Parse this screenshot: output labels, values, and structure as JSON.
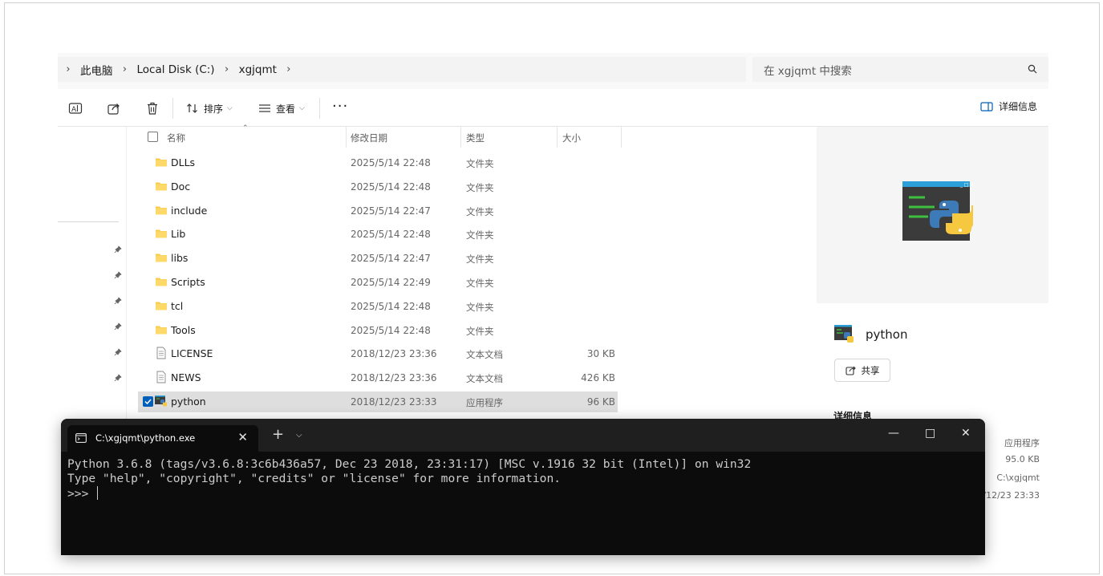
{
  "breadcrumb": {
    "items": [
      "此电脑",
      "Local Disk (C:)",
      "xgjqmt"
    ]
  },
  "search": {
    "placeholder": "在 xgjqmt 中搜索"
  },
  "toolbar": {
    "sort_label": "排序",
    "view_label": "查看",
    "more_label": "···",
    "details_label": "详细信息"
  },
  "columns": {
    "name": "名称",
    "date": "修改日期",
    "type": "类型",
    "size": "大小"
  },
  "files": [
    {
      "name": "DLLs",
      "date": "2025/5/14 22:48",
      "type": "文件夹",
      "size": "",
      "icon": "folder-icon"
    },
    {
      "name": "Doc",
      "date": "2025/5/14 22:48",
      "type": "文件夹",
      "size": "",
      "icon": "folder-icon"
    },
    {
      "name": "include",
      "date": "2025/5/14 22:47",
      "type": "文件夹",
      "size": "",
      "icon": "folder-icon"
    },
    {
      "name": "Lib",
      "date": "2025/5/14 22:48",
      "type": "文件夹",
      "size": "",
      "icon": "folder-icon"
    },
    {
      "name": "libs",
      "date": "2025/5/14 22:47",
      "type": "文件夹",
      "size": "",
      "icon": "folder-icon"
    },
    {
      "name": "Scripts",
      "date": "2025/5/14 22:49",
      "type": "文件夹",
      "size": "",
      "icon": "folder-icon"
    },
    {
      "name": "tcl",
      "date": "2025/5/14 22:48",
      "type": "文件夹",
      "size": "",
      "icon": "folder-icon"
    },
    {
      "name": "Tools",
      "date": "2025/5/14 22:48",
      "type": "文件夹",
      "size": "",
      "icon": "folder-icon"
    },
    {
      "name": "LICENSE",
      "date": "2018/12/23 23:36",
      "type": "文本文档",
      "size": "30 KB",
      "icon": "text-file-icon"
    },
    {
      "name": "NEWS",
      "date": "2018/12/23 23:36",
      "type": "文本文档",
      "size": "426 KB",
      "icon": "text-file-icon"
    },
    {
      "name": "python",
      "date": "2018/12/23 23:33",
      "type": "应用程序",
      "size": "96 KB",
      "icon": "python-exe-icon"
    }
  ],
  "preview": {
    "title": "python",
    "share_label": "共享",
    "details_heading": "详细信息",
    "detail_values": [
      "应用程序",
      "95.0 KB",
      "C:\\xgjqmt",
      "/12/23 23:33"
    ]
  },
  "terminal": {
    "tab_title": "C:\\xgjqmt\\python.exe",
    "lines": [
      "Python 3.6.8 (tags/v3.6.8:3c6b436a57, Dec 23 2018, 23:31:17) [MSC v.1916 32 bit (Intel)] on win32",
      "Type \"help\", \"copyright\", \"credits\" or \"license\" for more information."
    ],
    "prompt": ">>> "
  },
  "colors": {
    "accent": "#005fb8",
    "folder": "#f8c94a",
    "terminal_bg": "#0c0c0c"
  }
}
